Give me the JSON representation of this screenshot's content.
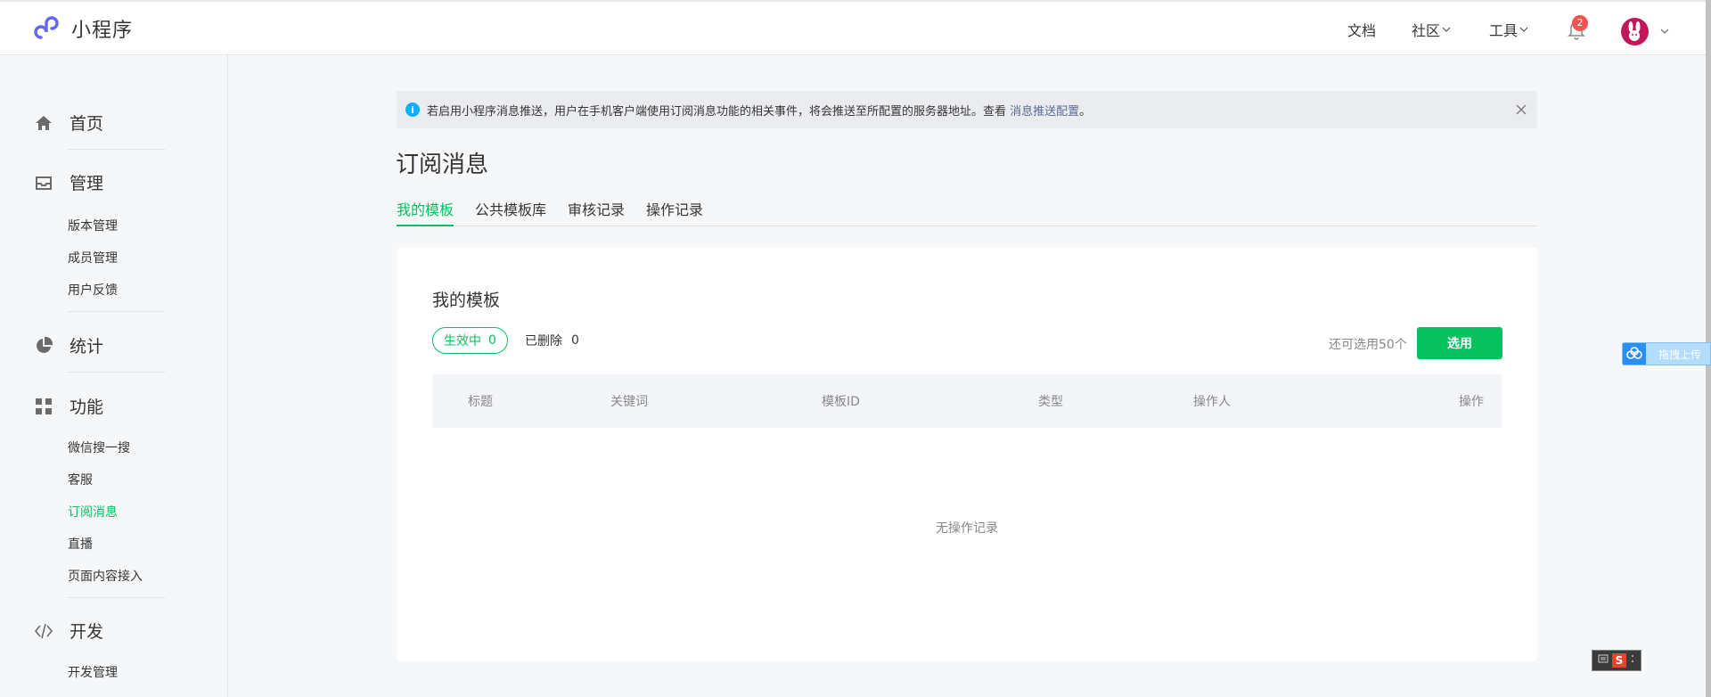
{
  "brand": {
    "name": "小程序"
  },
  "topnav": {
    "docs": "文档",
    "community": "社区",
    "tools": "工具",
    "notification_count": "2"
  },
  "sidebar": {
    "home": "首页",
    "manage": "管理",
    "manage_items": [
      "版本管理",
      "成员管理",
      "用户反馈"
    ],
    "stats": "统计",
    "features": "功能",
    "feature_items": [
      "微信搜一搜",
      "客服",
      "订阅消息",
      "直播",
      "页面内容接入"
    ],
    "develop": "开发",
    "develop_items": [
      "开发管理"
    ]
  },
  "notice": {
    "text": "若启用小程序消息推送，用户在手机客户端使用订阅消息功能的相关事件，将会推送至所配置的服务器地址。查看 ",
    "link": "消息推送配置",
    "period": "。"
  },
  "page": {
    "title": "订阅消息"
  },
  "tabs": [
    "我的模板",
    "公共模板库",
    "审核记录",
    "操作记录"
  ],
  "card": {
    "title": "我的模板",
    "active_label": "生效中",
    "active_count": "0",
    "deleted_label": "已删除",
    "deleted_count": "0",
    "remaining": "还可选用50个",
    "select_button": "选用",
    "columns": [
      "标题",
      "关键词",
      "模板ID",
      "类型",
      "操作人",
      "操作"
    ],
    "empty_text": "无操作记录"
  },
  "float_widget": {
    "text": "拖拽上传"
  },
  "colors": {
    "accent": "#07c160",
    "link": "#576b95",
    "badge": "#fa5151",
    "info": "#10aeff"
  }
}
